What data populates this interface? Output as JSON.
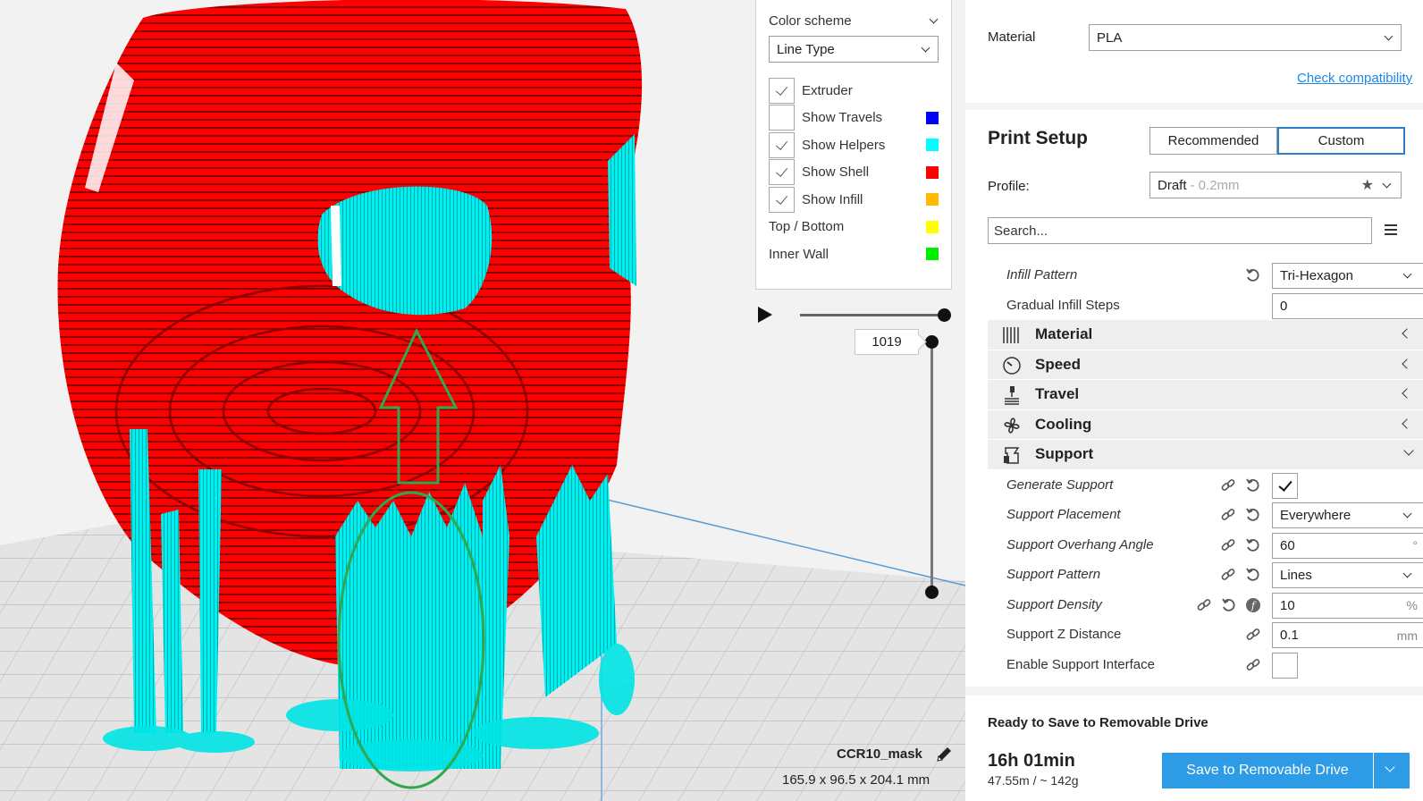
{
  "legend": {
    "header": "Color scheme",
    "selected": "Line Type",
    "items": [
      {
        "label": "Extruder",
        "checkbox": true,
        "checked": true,
        "color": ""
      },
      {
        "label": "Show Travels",
        "checkbox": true,
        "checked": false,
        "color": "#0000ff"
      },
      {
        "label": "Show Helpers",
        "checkbox": true,
        "checked": true,
        "color": "#00ffff"
      },
      {
        "label": "Show Shell",
        "checkbox": true,
        "checked": true,
        "color": "#ff0000"
      },
      {
        "label": "Show Infill",
        "checkbox": true,
        "checked": true,
        "color": "#ffbb00"
      },
      {
        "label": "Top / Bottom",
        "checkbox": false,
        "checked": false,
        "color": "#ffff00"
      },
      {
        "label": "Inner Wall",
        "checkbox": false,
        "checked": false,
        "color": "#00ee00"
      }
    ]
  },
  "layer": {
    "value": "1019"
  },
  "model": {
    "name": "CCR10_mask",
    "dimensions": "165.9 x 96.5 x 204.1 mm"
  },
  "material": {
    "label": "Material",
    "value": "PLA",
    "link": "Check compatibility"
  },
  "print_setup": {
    "title": "Print Setup",
    "tabs": {
      "recommended": "Recommended",
      "custom": "Custom"
    },
    "profile_label": "Profile:",
    "profile_value": "Draft",
    "profile_hint": "- 0.2mm",
    "search_placeholder": "Search..."
  },
  "settings": {
    "infill_pattern": {
      "label": "Infill Pattern",
      "value": "Tri-Hexagon"
    },
    "gradual_infill": {
      "label": "Gradual Infill Steps",
      "value": "0"
    },
    "categories": {
      "material": "Material",
      "speed": "Speed",
      "travel": "Travel",
      "cooling": "Cooling",
      "support": "Support"
    },
    "generate_support": {
      "label": "Generate Support",
      "checked": true
    },
    "support_placement": {
      "label": "Support Placement",
      "value": "Everywhere"
    },
    "support_overhang": {
      "label": "Support Overhang Angle",
      "value": "60",
      "unit": "°"
    },
    "support_pattern": {
      "label": "Support Pattern",
      "value": "Lines"
    },
    "support_density": {
      "label": "Support Density",
      "value": "10",
      "unit": "%"
    },
    "support_z_distance": {
      "label": "Support Z Distance",
      "value": "0.1",
      "unit": "mm"
    },
    "support_interface": {
      "label": "Enable Support Interface",
      "checked": false
    }
  },
  "output": {
    "title": "Ready to Save to Removable Drive",
    "time": "16h 01min",
    "usage": "47.55m / ~ 142g",
    "save_label": "Save to Removable Drive"
  },
  "colors": {
    "accent": "#2e9be6",
    "shell": "#ff0000",
    "helpers": "#00ffff",
    "annotation": "#2fa84f"
  }
}
